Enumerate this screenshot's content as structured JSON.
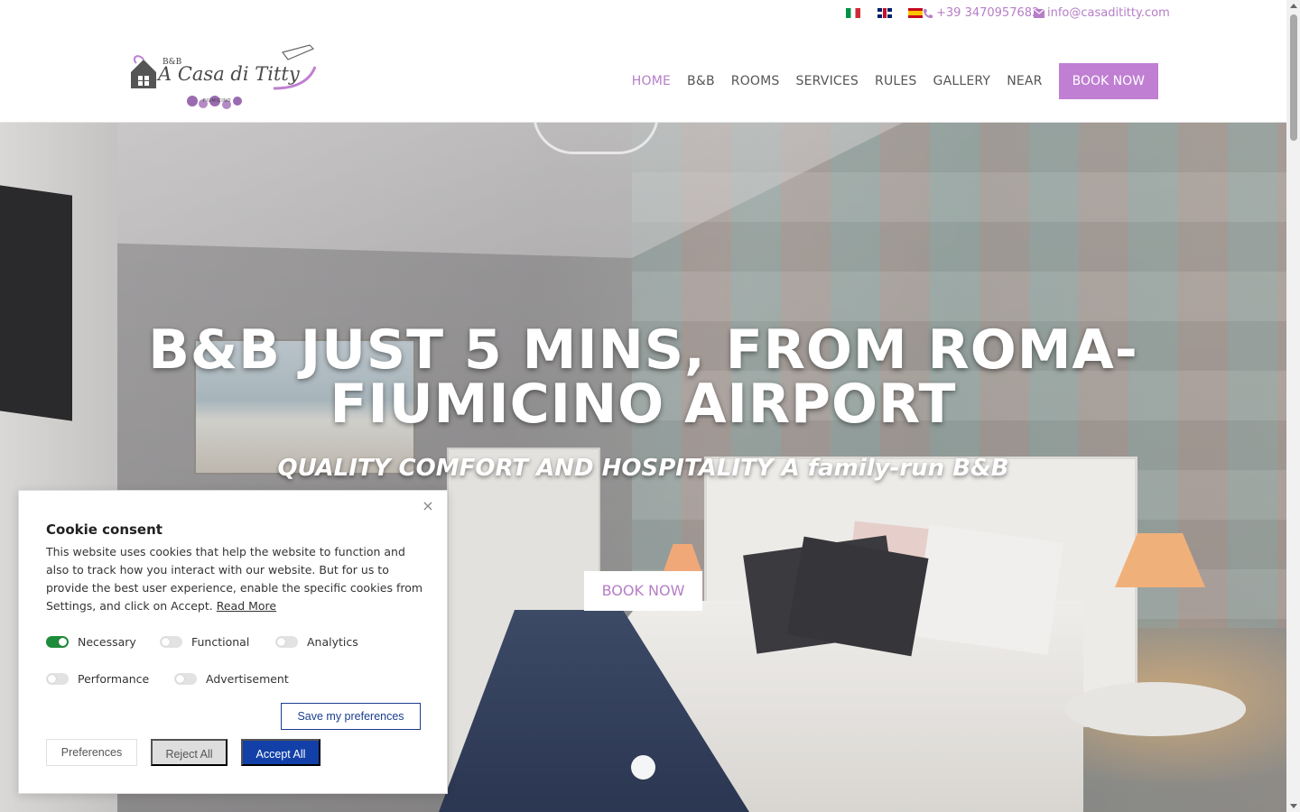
{
  "colors": {
    "accent": "#c07fd2",
    "link": "#b67ec8",
    "primary_button": "#1240a8",
    "toggle_on": "#1e8c3a"
  },
  "topbar": {
    "flags": [
      "it-flag-icon",
      "uk-flag-icon",
      "es-flag-icon"
    ],
    "phone": "+39 3470957682",
    "email": "info@casadititty.com"
  },
  "logo": {
    "bb": "B&B",
    "name": "A Casa di Titty",
    "sub": "FIUMICINO"
  },
  "nav": {
    "items": [
      "HOME",
      "B&B",
      "ROOMS",
      "SERVICES",
      "RULES",
      "GALLERY",
      "NEAR"
    ],
    "book": "BOOK NOW"
  },
  "hero": {
    "title": "B&B JUST 5 MINS, FROM ROMA-FIUMICINO AIRPORT",
    "subtitle": "QUALITY COMFORT AND HOSPITALITY A family-run B&B",
    "button": "BOOK NOW"
  },
  "cookie": {
    "close": "×",
    "title": "Cookie consent",
    "text": "This website uses cookies that help the website to function and also to track how you interact with our website. But for us to provide the best user experience, enable the specific cookies from Settings, and click on Accept.",
    "read_more": "Read More",
    "toggles": [
      {
        "label": "Necessary",
        "on": true
      },
      {
        "label": "Functional",
        "on": false
      },
      {
        "label": "Analytics",
        "on": false
      },
      {
        "label": "Performance",
        "on": false
      },
      {
        "label": "Advertisement",
        "on": false
      }
    ],
    "save": "Save my preferences",
    "preferences": "Preferences",
    "reject": "Reject All",
    "accept": "Accept All"
  }
}
